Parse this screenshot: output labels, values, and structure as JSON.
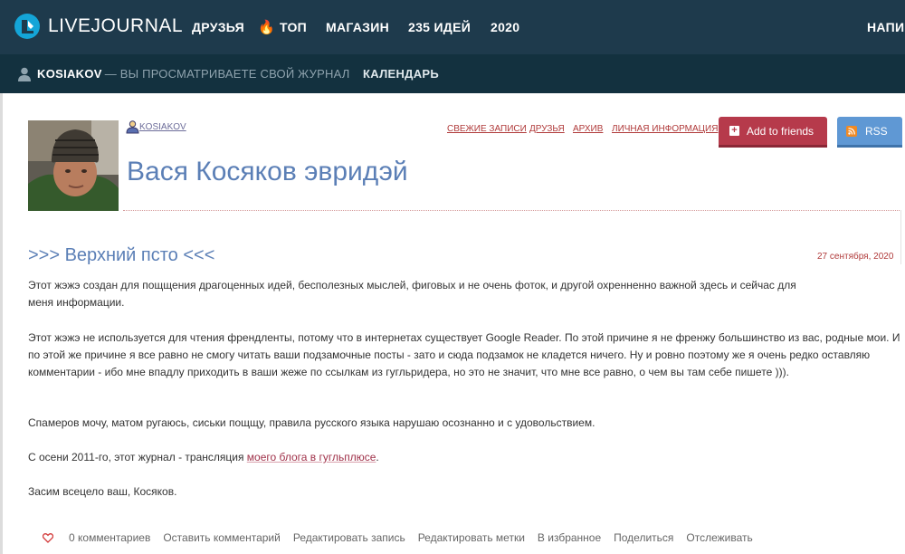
{
  "header": {
    "logo_text": "LIVEJOURNAL",
    "nav": [
      "ДРУЗЬЯ",
      "ТОП",
      "МАГАЗИН",
      "235 ИДЕЙ",
      "2020",
      "НАПИ"
    ]
  },
  "subbar": {
    "username": "KOSIAKOV",
    "viewing_note": "— ВЫ ПРОСМАТРИВАЕТЕ СВОЙ ЖУРНАЛ",
    "calendar": "КАЛЕНДАРЬ"
  },
  "journal": {
    "user_link": "KOSIAKOV",
    "title": "Вася Косяков эвридэй",
    "nav": [
      "СВЕЖИЕ ЗАПИСИ",
      "ДРУЗЬЯ",
      "АРХИВ",
      "ЛИЧНАЯ ИНФОРМАЦИЯ"
    ],
    "add_friends": "Add to friends",
    "rss": "RSS"
  },
  "post": {
    "title": ">>> Верхний псто <<<",
    "date": "27 сентября, 2020",
    "paragraphs": [
      "Этот жэжэ создан для пощщения драгоценных идей, бесполезных мыслей, фиговых и не очень фоток, и другой охренненно важной здесь и сейчас для меня информации.",
      "Этот жэжэ не используется для чтения френдленты, потому что в интернетах существует Google Reader. По этой причине я не френжу большинство из вас, родные мои. И по этой же причине я все равно не смогу читать ваши подзамочные посты - зато и сюда подзамок не кладется ничего. Ну и ровно поэтому же я очень редко оставляю комментарии - ибо мне впадлу приходить в ваши жеже по ссылкам из гугльридера, но это не значит, что мне все равно, о чем вы там себе пишете ))).",
      "Спамеров мочу, матом ругаюсь, сиськи пощщу, правила русского языка нарушаю осознанно и с удовольствием.",
      "С осени 2011-го, этот журнал - трансляция ",
      "Засим всецело ваш, Косяков."
    ],
    "link_text": "моего блога в гугльплюсе",
    "link_suffix": ".",
    "actions": [
      "0 комментариев",
      "Оставить комментарий",
      "Редактировать запись",
      "Редактировать метки",
      "В избранное",
      "Поделиться",
      "Отслеживать"
    ]
  },
  "colors": {
    "topbar": "#1e3a4c",
    "subbar": "#13313f",
    "title_blue": "#5b7fb6",
    "accent_red": "#b03a3a",
    "add_button": "#b63a4b",
    "rss_button": "#5f98d4"
  },
  "icons": [
    "livejournal-logo-icon",
    "fire-icon",
    "user-icon",
    "plus-icon",
    "rss-icon",
    "heart-icon"
  ]
}
